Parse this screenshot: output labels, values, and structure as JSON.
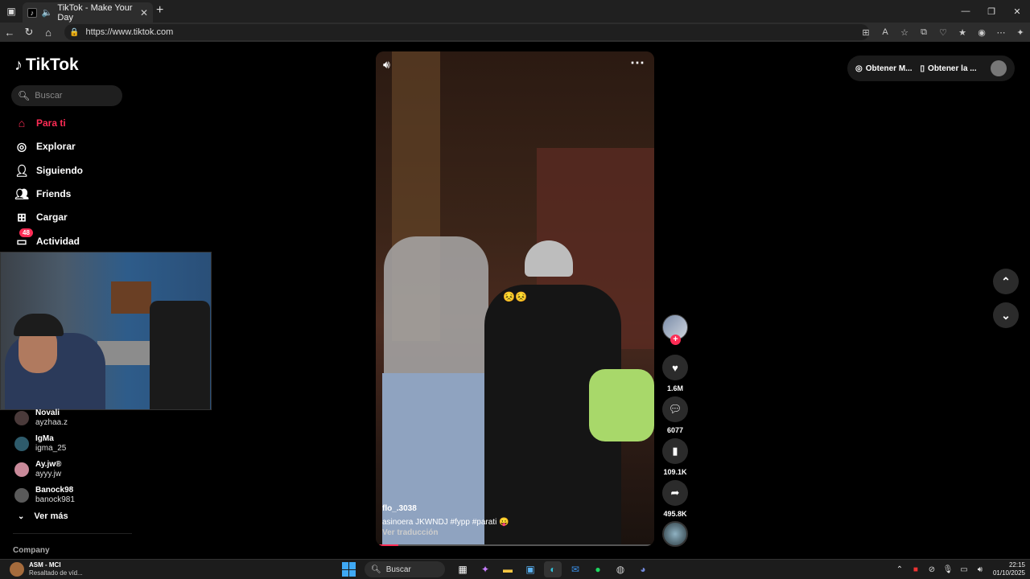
{
  "browser": {
    "tab_title": "TikTok - Make Your Day",
    "url": "https://www.tiktok.com"
  },
  "sidebar": {
    "logo": "TikTok",
    "search_placeholder": "Buscar",
    "menu": [
      {
        "label": "Para ti",
        "icon": "home-icon"
      },
      {
        "label": "Explorar",
        "icon": "compass-icon"
      },
      {
        "label": "Siguiendo",
        "icon": "following-icon"
      },
      {
        "label": "Friends",
        "icon": "friends-icon"
      },
      {
        "label": "Cargar",
        "icon": "upload-icon"
      },
      {
        "label": "Actividad",
        "icon": "inbox-icon",
        "badge": "48"
      }
    ],
    "suggested": [
      {
        "name": "Novali",
        "handle": "ayzhaa.z"
      },
      {
        "name": "IgMa",
        "handle": "igma_25"
      },
      {
        "name": "Ay.jw®",
        "handle": "ayyy.jw"
      },
      {
        "name": "Banock98",
        "handle": "banock981"
      }
    ],
    "ver_mas": "Ver más",
    "company": "Company"
  },
  "video": {
    "username": "flo_.3038",
    "caption": "asinoera JKWNDJ #fypp  #parati  😛",
    "translate": "Ver traducción",
    "overlay_emoji": "😣😣",
    "progress": 0.08
  },
  "actions": {
    "likes": "1.6M",
    "comments": "6077",
    "saves": "109.1K",
    "shares": "495.8K"
  },
  "topright": {
    "coins": "Obtener M...",
    "app": "Obtener la ..."
  },
  "taskbar": {
    "app_title": "ASM - MCI",
    "app_sub": "Resaltado de víd...",
    "search": "Buscar",
    "time": "22:15",
    "date": "01/10/2025"
  },
  "colors": {
    "accent": "#fe2c55",
    "background": "#000000"
  }
}
